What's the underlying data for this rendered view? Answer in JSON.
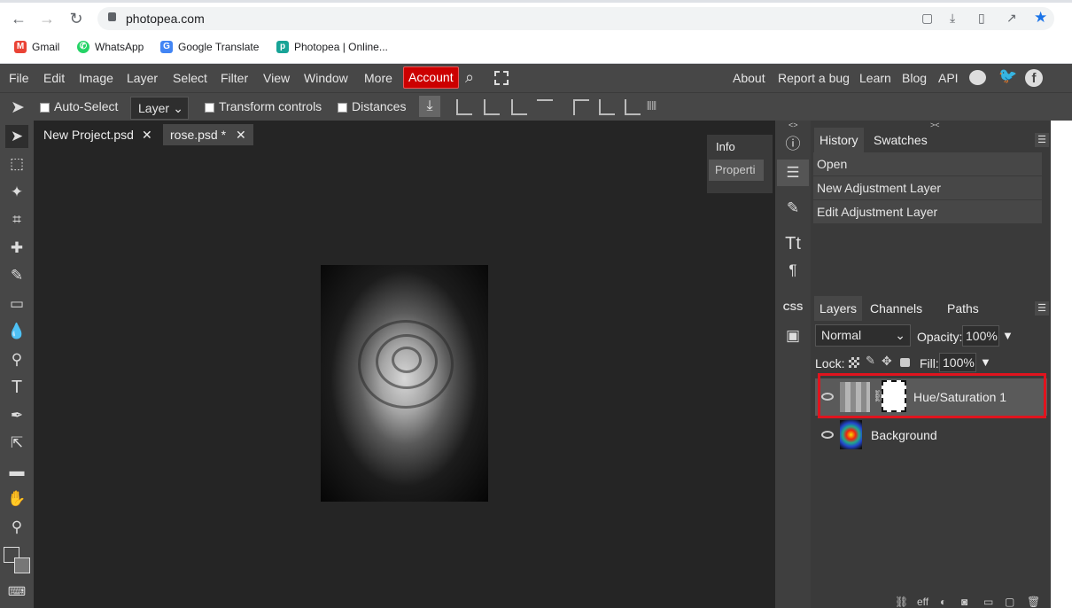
{
  "browser": {
    "url": "photopea.com",
    "bookmarks": [
      {
        "label": "Gmail",
        "icon": "gmail-icon",
        "color": "#ea4335"
      },
      {
        "label": "WhatsApp",
        "icon": "whatsapp-icon",
        "color": "#25d366"
      },
      {
        "label": "Google Translate",
        "icon": "google-translate-icon",
        "color": "#4285f4"
      },
      {
        "label": "Photopea | Online...",
        "icon": "photopea-icon",
        "color": "#18a497"
      }
    ]
  },
  "menubar": {
    "items": [
      "File",
      "Edit",
      "Image",
      "Layer",
      "Select",
      "Filter",
      "View",
      "Window",
      "More"
    ],
    "account": "Account",
    "right_links": [
      "About",
      "Report a bug",
      "Learn",
      "Blog",
      "API"
    ]
  },
  "options": {
    "auto_select": "Auto-Select",
    "layer_select": "Layer",
    "transform_controls": "Transform controls",
    "distances": "Distances"
  },
  "tabs": [
    {
      "label": "New Project.psd"
    },
    {
      "label": "rose.psd *"
    }
  ],
  "mini_panel": {
    "info": "Info",
    "properties": "Properti"
  },
  "history_panel": {
    "tabs": [
      "History",
      "Swatches"
    ],
    "items": [
      "Open",
      "New Adjustment Layer",
      "Edit Adjustment Layer"
    ]
  },
  "layers_panel": {
    "tabs": [
      "Layers",
      "Channels",
      "Paths"
    ],
    "blend_mode": "Normal",
    "opacity_label": "Opacity:",
    "opacity_value": "100%",
    "lock_label": "Lock:",
    "fill_label": "Fill:",
    "fill_value": "100%",
    "layers": [
      {
        "name": "Hue/Saturation 1"
      },
      {
        "name": "Background"
      }
    ]
  },
  "colors": {
    "highlight": "#e0141e",
    "account": "#cc0000",
    "panel": "#3a3a3a"
  }
}
